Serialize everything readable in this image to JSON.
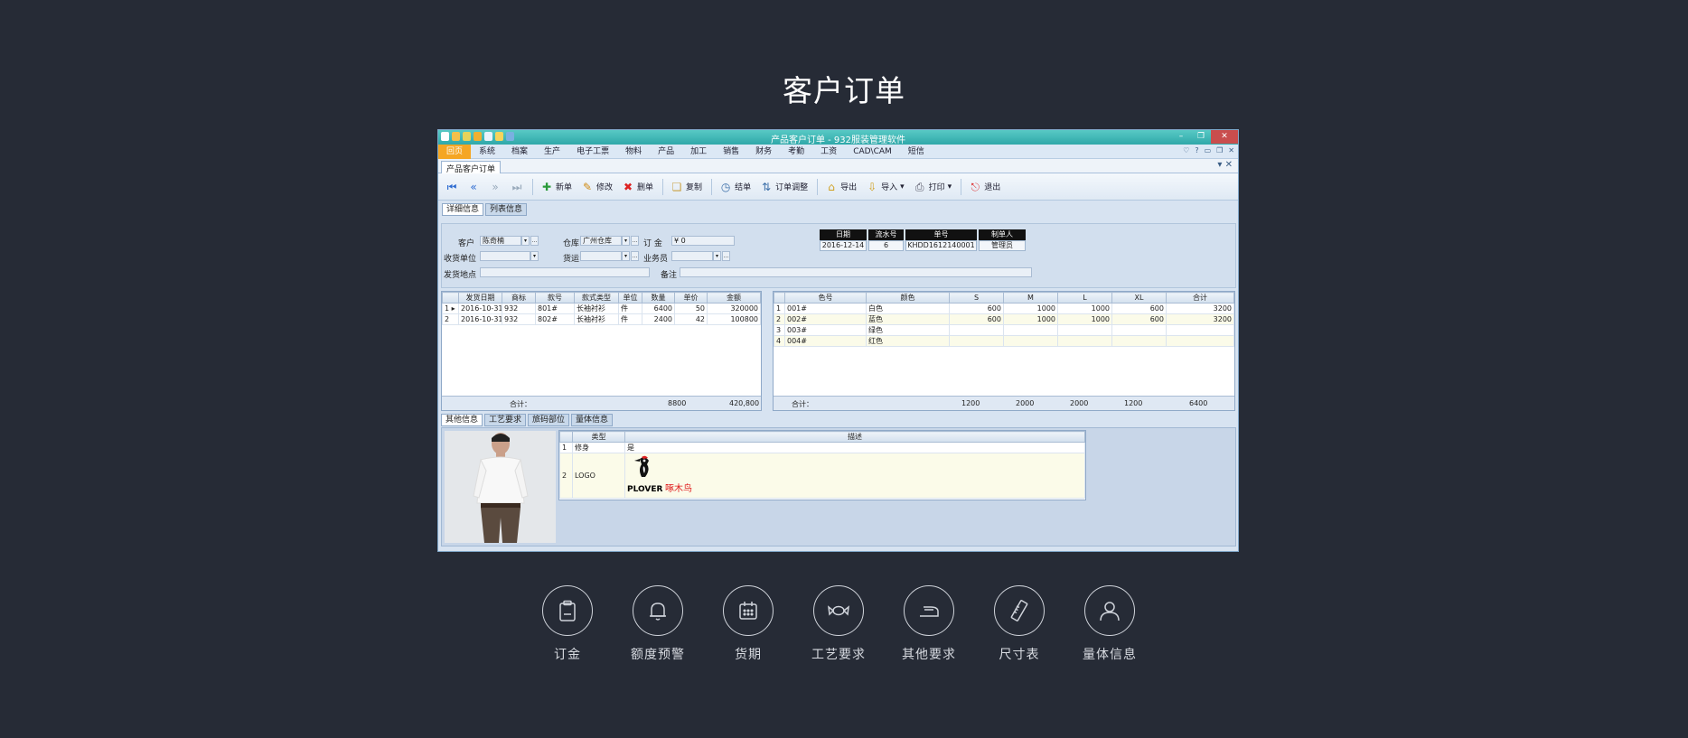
{
  "page_title": "客户订单",
  "window": {
    "title": "产品客户订单 - 932服装管理软件",
    "menu": [
      "回页",
      "系统",
      "档案",
      "生产",
      "电子工票",
      "物料",
      "产品",
      "加工",
      "销售",
      "财务",
      "考勤",
      "工资",
      "CAD\\CAM",
      "短信"
    ],
    "doc_tab": "产品客户订单",
    "toolbar": {
      "new": "新单",
      "edit": "修改",
      "delete": "删单",
      "copy": "复制",
      "close_order": "结单",
      "adjust": "订单调整",
      "export": "导出",
      "import": "导入",
      "print": "打印",
      "exit": "退出"
    },
    "subtabs": [
      "详细信息",
      "列表信息"
    ]
  },
  "form": {
    "customer_label": "客户",
    "customer_value": "陈奇楠",
    "warehouse_label": "仓库",
    "warehouse_value": "广州仓库",
    "deposit_label": "订 金",
    "deposit_value": "¥ 0",
    "receiver_label": "收货单位",
    "receiver_value": "",
    "freight_label": "货运",
    "freight_value": "",
    "salesman_label": "业务员",
    "salesman_value": "",
    "ship_place_label": "发货地点",
    "ship_place_value": "",
    "remark_label": "备注",
    "remark_value": "",
    "header": {
      "date_label": "日期",
      "date_value": "2016-12-14",
      "serial_label": "流水号",
      "serial_value": "6",
      "order_no_label": "单号",
      "order_no_value": "KHDD1612140001",
      "creator_label": "制单人",
      "creator_value": "管理员"
    }
  },
  "left_grid": {
    "columns": [
      "发货日期",
      "商标",
      "款号",
      "款式类型",
      "单位",
      "数量",
      "单价",
      "金额"
    ],
    "rows": [
      [
        "2016-10-31",
        "932",
        "801#",
        "长袖衬衫",
        "件",
        "6400",
        "50",
        "320000"
      ],
      [
        "2016-10-31",
        "932",
        "802#",
        "长袖衬衫",
        "件",
        "2400",
        "42",
        "100800"
      ]
    ],
    "footer_label": "合计：",
    "footer_qty": "8800",
    "footer_amount": "420,800"
  },
  "right_grid": {
    "columns": [
      "色号",
      "颜色",
      "S",
      "M",
      "L",
      "XL",
      "合计"
    ],
    "rows": [
      [
        "001#",
        "白色",
        "600",
        "1000",
        "1000",
        "600",
        "3200"
      ],
      [
        "002#",
        "蓝色",
        "600",
        "1000",
        "1000",
        "600",
        "3200"
      ],
      [
        "003#",
        "绿色",
        "",
        "",
        "",
        "",
        ""
      ],
      [
        "004#",
        "红色",
        "",
        "",
        "",
        "",
        ""
      ]
    ],
    "footer_label": "合计：",
    "footer_values": [
      "1200",
      "2000",
      "2000",
      "1200",
      "6400"
    ]
  },
  "bottom": {
    "tabs": [
      "其他信息",
      "工艺要求",
      "旅码部位",
      "量体信息"
    ],
    "grid_columns": [
      "类型",
      "描述"
    ],
    "rows": [
      {
        "num": "1",
        "type": "修身",
        "desc": "是"
      },
      {
        "num": "2",
        "type": "LOGO",
        "logo_en": "PLOVER",
        "logo_cn": "啄木鸟"
      }
    ]
  },
  "features": [
    {
      "label": "订金",
      "icon": "clipboard-icon"
    },
    {
      "label": "额度预警",
      "icon": "bell-icon"
    },
    {
      "label": "货期",
      "icon": "calendar-icon"
    },
    {
      "label": "工艺要求",
      "icon": "candy-icon"
    },
    {
      "label": "其他要求",
      "icon": "iron-icon"
    },
    {
      "label": "尺寸表",
      "icon": "ruler-icon"
    },
    {
      "label": "量体信息",
      "icon": "user-icon"
    }
  ]
}
